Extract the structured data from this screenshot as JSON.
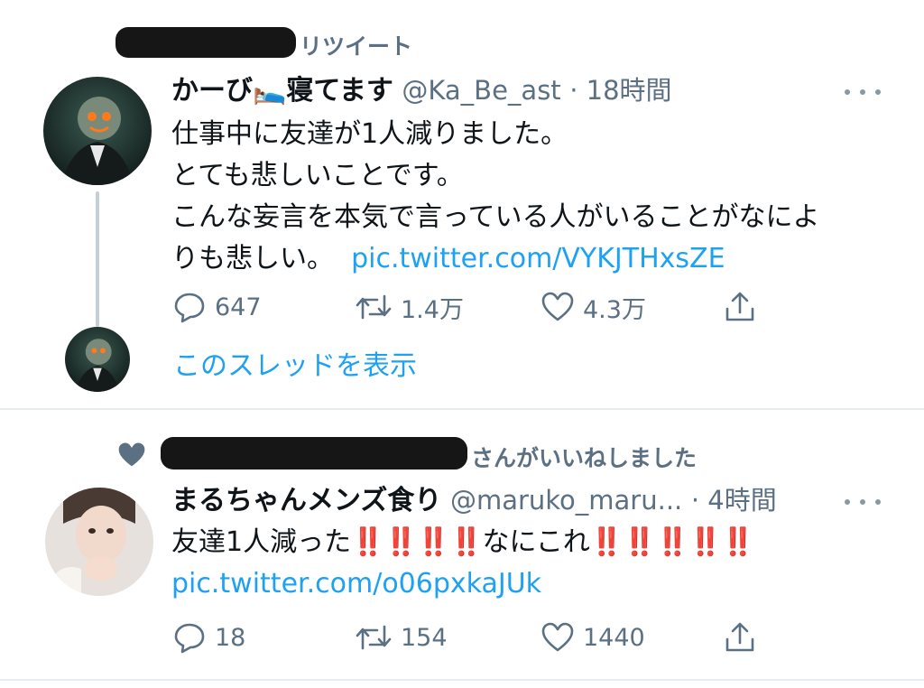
{
  "tweet1": {
    "context_label": "リツイート",
    "name": "かーび🛌寝てます",
    "handle": "@Ka_Be_ast",
    "time": "· 18時間",
    "lines": [
      "仕事中に友達が1人減りました。",
      "とても悲しいことです。",
      "こんな妄言を本気で言っている人がいることがなによ"
    ],
    "last_line": "りも悲しい。",
    "link": "pic.twitter.com/VYKJTHxsZE",
    "replies": "647",
    "retweets": "1.4万",
    "likes": "4.3万",
    "thread_label": "このスレッドを表示"
  },
  "tweet2": {
    "context_label": "さんがいいねしました",
    "name": "まるちゃんメンズ食り",
    "handle": "@maruko_maru...",
    "time": "· 4時間",
    "text_a": "友達1人減った",
    "excl_a": "‼️‼️‼️‼️",
    "text_b": "なにこれ",
    "excl_b": "‼️‼️‼️‼️‼️",
    "link": "pic.twitter.com/o06pxkaJUk",
    "replies": "18",
    "retweets": "154",
    "likes": "1440"
  },
  "icons": [
    "retweet-icon",
    "heart-icon",
    "more-icon",
    "reply-icon",
    "share-icon"
  ],
  "colors": {
    "link": "#1da1f2",
    "muted": "#5b7083",
    "exclamation": "#e0112b"
  }
}
